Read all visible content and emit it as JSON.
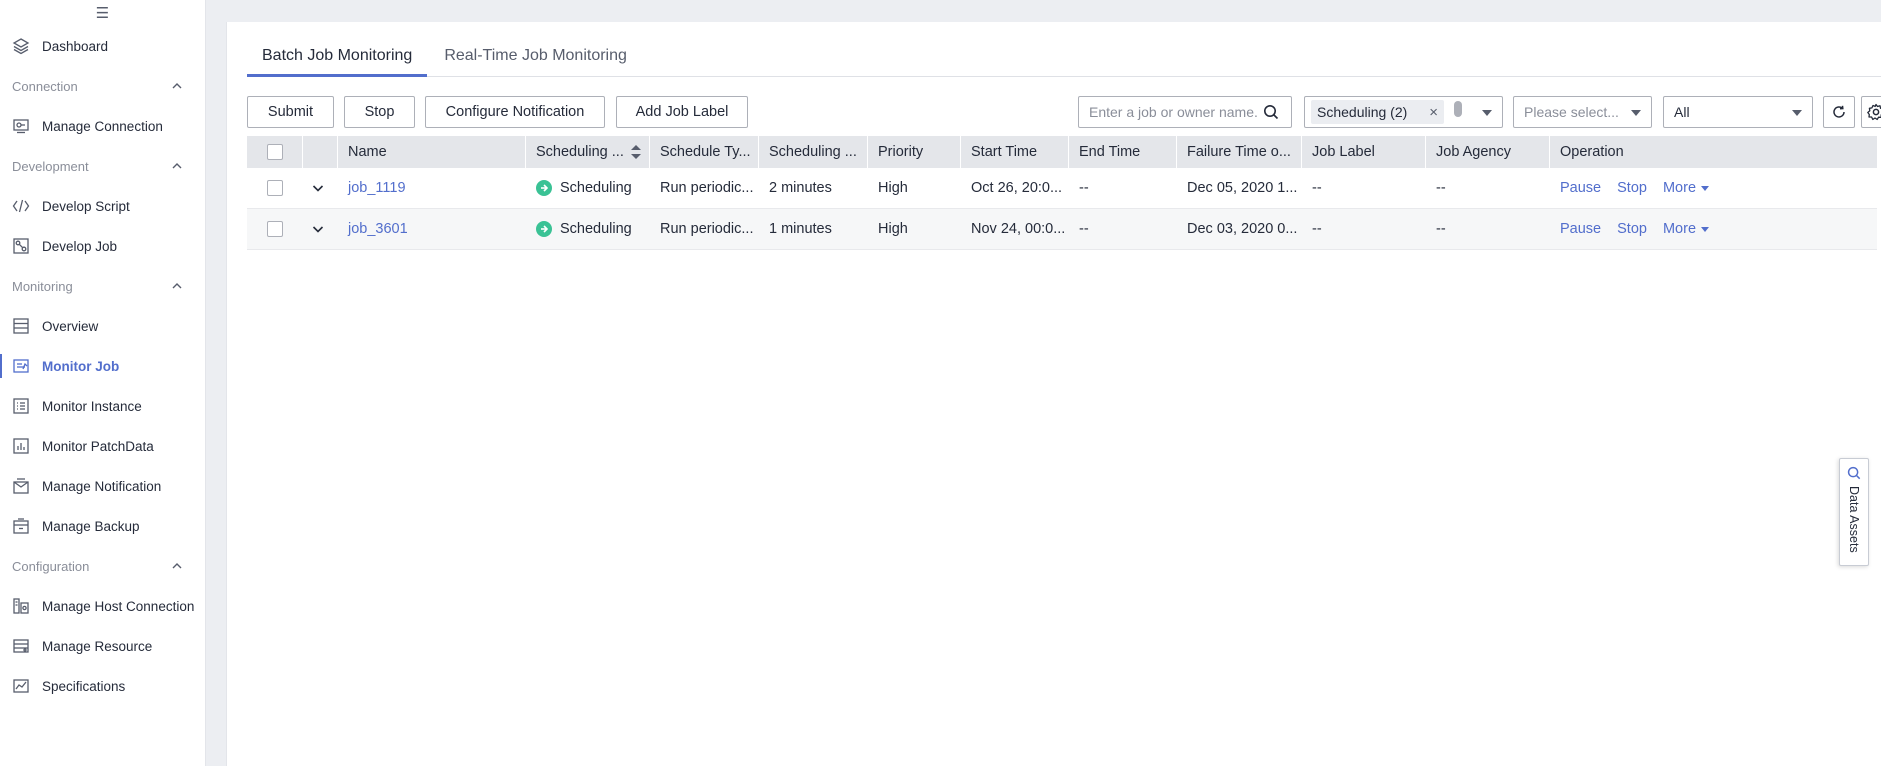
{
  "sidebar": {
    "items": [
      {
        "type": "item",
        "label": "Dashboard",
        "icon": "layers-icon"
      },
      {
        "type": "section",
        "label": "Connection"
      },
      {
        "type": "item",
        "label": "Manage Connection",
        "icon": "connection-icon"
      },
      {
        "type": "section",
        "label": "Development"
      },
      {
        "type": "item",
        "label": "Develop Script",
        "icon": "code-icon"
      },
      {
        "type": "item",
        "label": "Develop Job",
        "icon": "workflow-icon"
      },
      {
        "type": "section",
        "label": "Monitoring"
      },
      {
        "type": "item",
        "label": "Overview",
        "icon": "overview-icon"
      },
      {
        "type": "item",
        "label": "Monitor Job",
        "icon": "monitor-job-icon",
        "active": true
      },
      {
        "type": "item",
        "label": "Monitor Instance",
        "icon": "list-icon"
      },
      {
        "type": "item",
        "label": "Monitor PatchData",
        "icon": "bar-chart-icon"
      },
      {
        "type": "item",
        "label": "Manage Notification",
        "icon": "notification-icon"
      },
      {
        "type": "item",
        "label": "Manage Backup",
        "icon": "backup-icon"
      },
      {
        "type": "section",
        "label": "Configuration"
      },
      {
        "type": "item",
        "label": "Manage Host Connection",
        "icon": "host-icon"
      },
      {
        "type": "item",
        "label": "Manage Resource",
        "icon": "resource-icon"
      },
      {
        "type": "item",
        "label": "Specifications",
        "icon": "chart-line-icon"
      }
    ]
  },
  "tabs": [
    {
      "label": "Batch Job Monitoring",
      "active": true
    },
    {
      "label": "Real-Time Job Monitoring",
      "active": false
    }
  ],
  "toolbar": {
    "submit_label": "Submit",
    "stop_label": "Stop",
    "configure_notification_label": "Configure Notification",
    "add_job_label_label": "Add Job Label",
    "search_placeholder": "Enter a job or owner name.",
    "status_chip": "Scheduling (2)",
    "select_placeholder": "Please select...",
    "all_label": "All"
  },
  "table": {
    "headers": [
      "Name",
      "Scheduling ...",
      "Schedule Ty...",
      "Scheduling ...",
      "Priority",
      "Start Time",
      "End Time",
      "Failure Time o...",
      "Job Label",
      "Job Agency",
      "Operation"
    ],
    "rows": [
      {
        "name": "job_1119",
        "status": "Scheduling",
        "schedule_type": "Run periodic...",
        "interval": "2 minutes",
        "priority": "High",
        "start_time": "Oct 26, 20:0...",
        "end_time": "--",
        "failure_time": "Dec 05, 2020 1...",
        "job_label": "--",
        "job_agency": "--"
      },
      {
        "name": "job_3601",
        "status": "Scheduling",
        "schedule_type": "Run periodic...",
        "interval": "1 minutes",
        "priority": "High",
        "start_time": "Nov 24, 00:0...",
        "end_time": "--",
        "failure_time": "Dec 03, 2020 0...",
        "job_label": "--",
        "job_agency": "--"
      }
    ],
    "op_pause": "Pause",
    "op_stop": "Stop",
    "op_more": "More"
  },
  "floating": {
    "data_assets_label": "Data Assets"
  },
  "colors": {
    "accent": "#526ecc",
    "status_green": "#3ac295"
  }
}
